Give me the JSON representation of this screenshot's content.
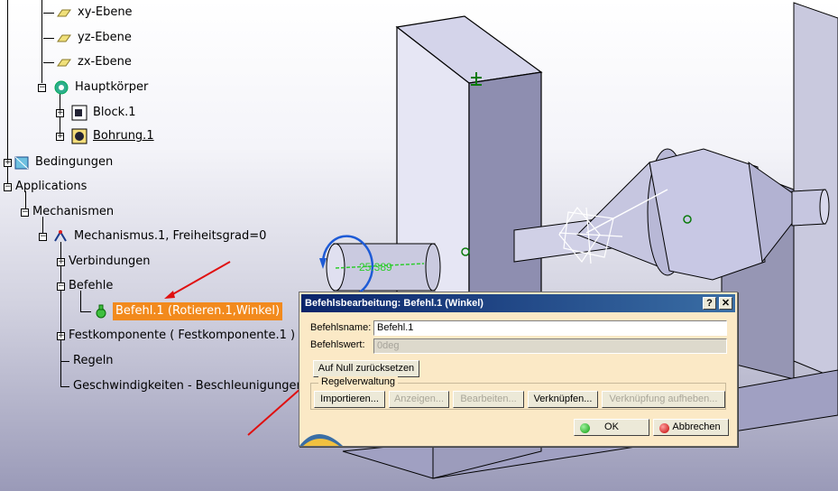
{
  "tree": {
    "nodes": [
      {
        "label": "xy-Ebene"
      },
      {
        "label": "yz-Ebene"
      },
      {
        "label": "zx-Ebene"
      },
      {
        "label": "Hauptkörper"
      },
      {
        "label": "Block.1"
      },
      {
        "label": "Bohrung.1"
      },
      {
        "label": "Bedingungen"
      },
      {
        "label": "Applications"
      },
      {
        "label": "Mechanismen"
      },
      {
        "label": "Mechanismus.1, Freiheitsgrad=0"
      },
      {
        "label": "Verbindungen"
      },
      {
        "label": "Befehle"
      },
      {
        "label": "Befehl.1 (Rotieren.1,Winkel)"
      },
      {
        "label": "Festkomponente ( Festkomponente.1 )"
      },
      {
        "label": "Regeln"
      },
      {
        "label": "Geschwindigkeiten - Beschleunigungen"
      }
    ]
  },
  "viewport": {
    "dimension_label": "25.389"
  },
  "dialog": {
    "title": "Befehlsbearbeitung: Befehl.1 (Winkel)",
    "help_label": "?",
    "close_label": "✕",
    "name_label": "Befehlsname:",
    "name_value": "Befehl.1",
    "value_label": "Befehlswert:",
    "value_value": "0deg",
    "reset_label": "Auf Null zurücksetzen",
    "group_label": "Regelverwaltung",
    "import_label": "Importieren...",
    "show_label": "Anzeigen...",
    "edit_label": "Bearbeiten...",
    "link_label": "Verknüpfen...",
    "unlink_label": "Verknüpfung aufheben...",
    "ok_label": "OK",
    "cancel_label": "Abbrechen"
  },
  "colors": {
    "selection": "#f28a1d",
    "title_bar": "#0a246a",
    "dialog_bg": "#fbe9c6",
    "annotation_arrow": "#e01010",
    "dimension": "#2ecc2e",
    "rotation_handle": "#1e5bd6"
  }
}
